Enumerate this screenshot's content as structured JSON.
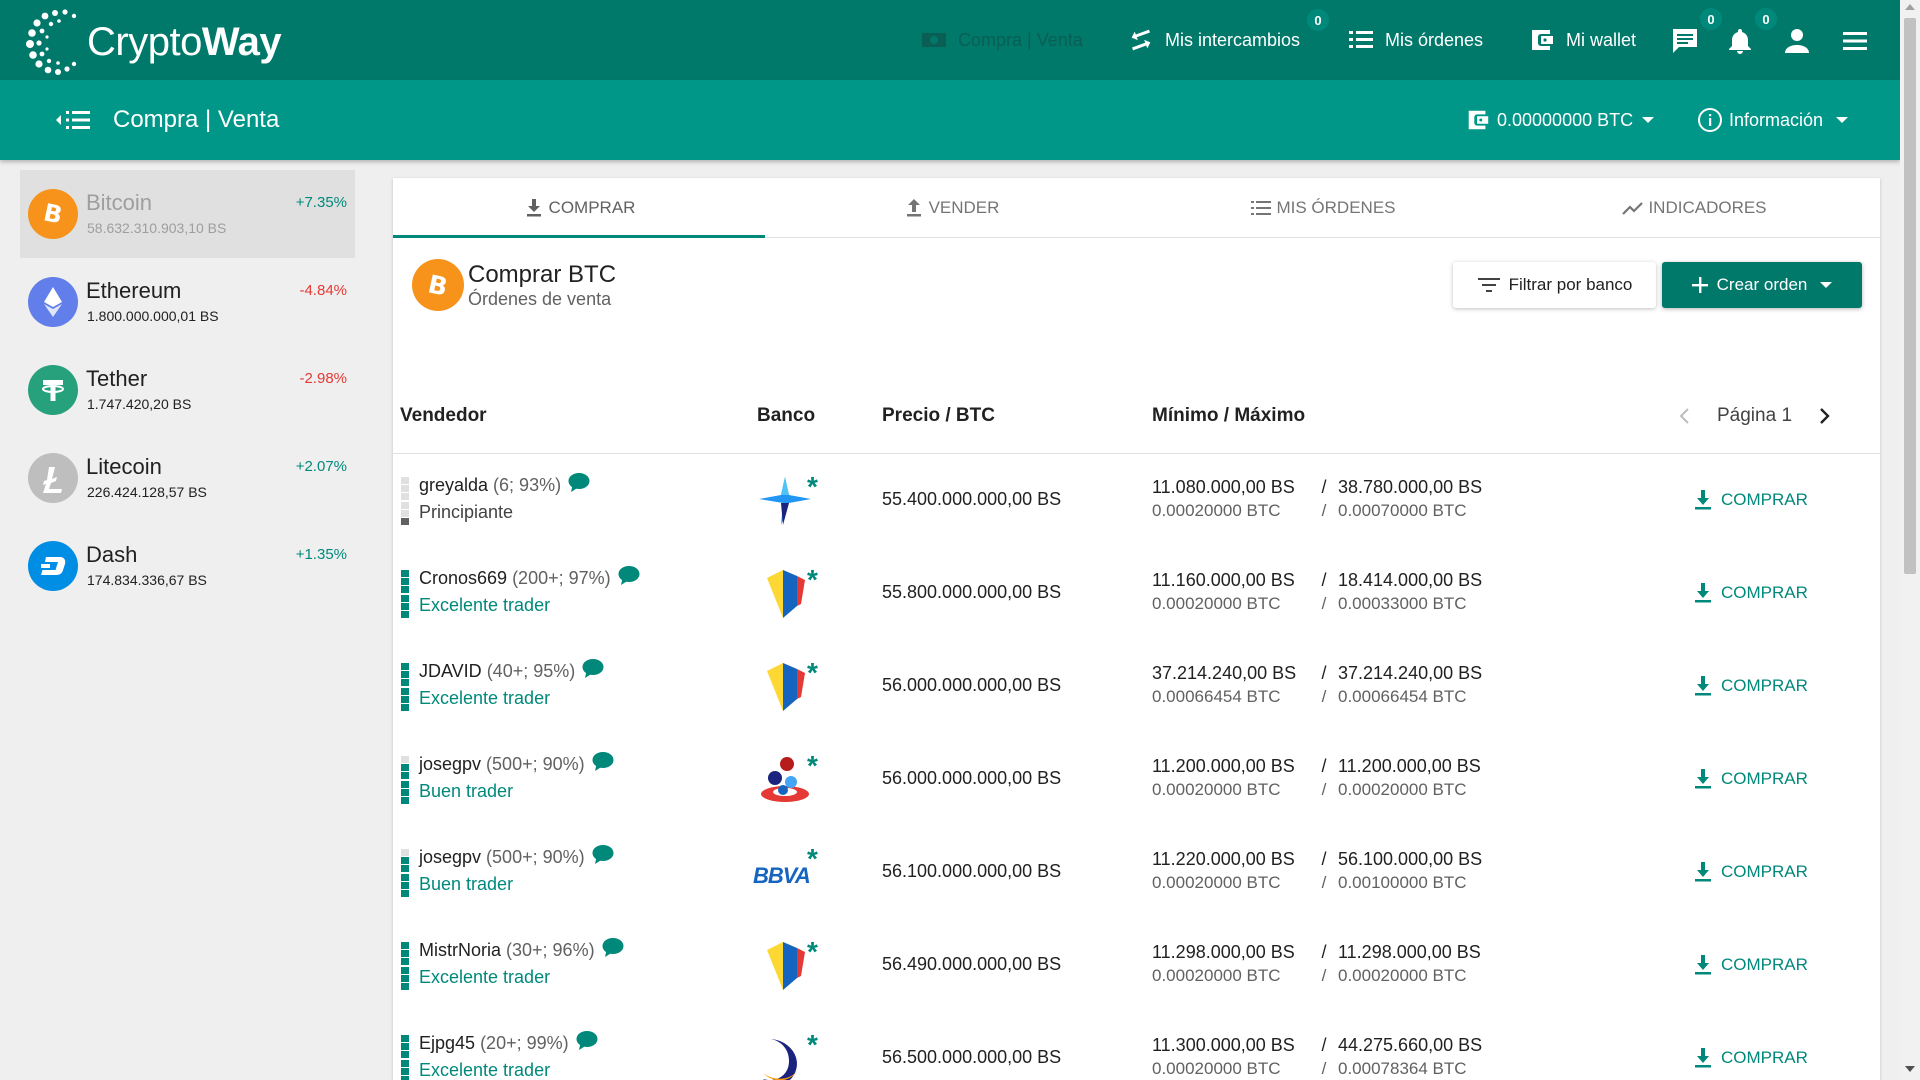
{
  "logo": {
    "part1": "Crypto",
    "part2": "Way"
  },
  "topnav": {
    "compra_venta": "Compra | Venta",
    "intercambios": "Mis intercambios",
    "intercambios_badge": "0",
    "ordenes": "Mis órdenes",
    "wallet": "Mi wallet",
    "messages_badge": "0",
    "notifications_badge": "0"
  },
  "subbar": {
    "title": "Compra | Venta",
    "balance": "0.00000000 BTC",
    "info": "Información"
  },
  "sidebar": {
    "coins": [
      {
        "name": "Bitcoin",
        "price": "58.632.310.903,10 BS",
        "change": "+7.35%",
        "color": "#f7931a"
      },
      {
        "name": "Ethereum",
        "price": "1.800.000.000,01 BS",
        "change": "-4.84%",
        "color": "#627eea"
      },
      {
        "name": "Tether",
        "price": "1.747.420,20 BS",
        "change": "-2.98%",
        "color": "#26a17b"
      },
      {
        "name": "Litecoin",
        "price": "226.424.128,57 BS",
        "change": "+2.07%",
        "color": "#bebebe"
      },
      {
        "name": "Dash",
        "price": "174.834.336,67 BS",
        "change": "+1.35%",
        "color": "#008de4"
      }
    ]
  },
  "tabs": {
    "comprar": "COMPRAR",
    "vender": "VENDER",
    "mis_ordenes": "MIS ÓRDENES",
    "indicadores": "INDICADORES"
  },
  "header": {
    "title": "Comprar BTC",
    "subtitle": "Órdenes de venta",
    "filter": "Filtrar por banco",
    "create": "Crear orden"
  },
  "table": {
    "columns": {
      "seller": "Vendedor",
      "bank": "Banco",
      "price": "Precio / BTC",
      "minmax": "Mínimo / Máximo"
    },
    "page": "Página 1",
    "action_label": "COMPRAR",
    "rows": [
      {
        "name": "greyalda",
        "stats": "(6; 93%)",
        "rank": "Principiante",
        "rank_type": "beg",
        "level": 1,
        "bank": "star",
        "price": "55.400.000.000,00 BS",
        "min_bs": "11.080.000,00 BS",
        "max_bs": "38.780.000,00 BS",
        "min_btc": "0.00020000 BTC",
        "max_btc": "0.00070000 BTC"
      },
      {
        "name": "Cronos669",
        "stats": "(200+; 97%)",
        "rank": "Excelente trader",
        "rank_type": "good",
        "level": 6,
        "bank": "venezuela",
        "price": "55.800.000.000,00 BS",
        "min_bs": "11.160.000,00 BS",
        "max_bs": "18.414.000,00 BS",
        "min_btc": "0.00020000 BTC",
        "max_btc": "0.00033000 BTC"
      },
      {
        "name": "JDAVID",
        "stats": "(40+; 95%)",
        "rank": "Excelente trader",
        "rank_type": "good",
        "level": 6,
        "bank": "venezuela",
        "price": "56.000.000.000,00 BS",
        "min_bs": "37.214.240,00 BS",
        "max_bs": "37.214.240,00 BS",
        "min_btc": "0.00066454 BTC",
        "max_btc": "0.00066454 BTC"
      },
      {
        "name": "josegpv",
        "stats": "(500+; 90%)",
        "rank": "Buen trader",
        "rank_type": "good",
        "level": 5,
        "bank": "mercantil",
        "price": "56.000.000.000,00 BS",
        "min_bs": "11.200.000,00 BS",
        "max_bs": "11.200.000,00 BS",
        "min_btc": "0.00020000 BTC",
        "max_btc": "0.00020000 BTC"
      },
      {
        "name": "josegpv",
        "stats": "(500+; 90%)",
        "rank": "Buen trader",
        "rank_type": "good",
        "level": 5,
        "bank": "bbva",
        "bank_text": "BBVA",
        "price": "56.100.000.000,00 BS",
        "min_bs": "11.220.000,00 BS",
        "max_bs": "56.100.000,00 BS",
        "min_btc": "0.00020000 BTC",
        "max_btc": "0.00100000 BTC"
      },
      {
        "name": "MistrNoria",
        "stats": "(30+; 96%)",
        "rank": "Excelente trader",
        "rank_type": "good",
        "level": 6,
        "bank": "venezuela",
        "price": "56.490.000.000,00 BS",
        "min_bs": "11.298.000,00 BS",
        "max_bs": "11.298.000,00 BS",
        "min_btc": "0.00020000 BTC",
        "max_btc": "0.00020000 BTC"
      },
      {
        "name": "Ejpg45",
        "stats": "(20+; 99%)",
        "rank": "Excelente trader",
        "rank_type": "good",
        "level": 6,
        "bank": "crescent",
        "price": "56.500.000.000,00 BS",
        "min_bs": "11.300.000,00 BS",
        "max_bs": "44.275.660,00 BS",
        "min_btc": "0.00020000 BTC",
        "max_btc": "0.00078364 BTC"
      }
    ]
  },
  "colors": {
    "nav": "#00796b",
    "subbar": "#009688",
    "accent": "#00897b",
    "negative": "#e53935"
  }
}
